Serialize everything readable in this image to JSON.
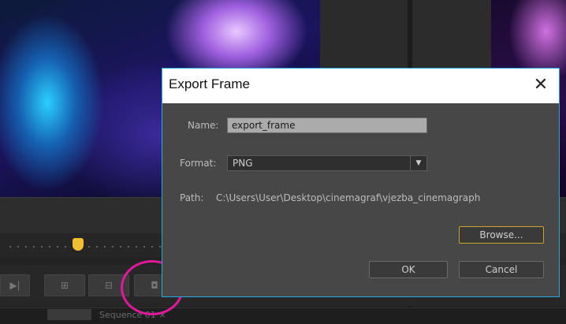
{
  "dialog": {
    "title": "Export Frame",
    "close_glyph": "✕",
    "name_label": "Name:",
    "name_value": "export_frame",
    "format_label": "Format:",
    "format_value": "PNG",
    "format_arrow": "▼",
    "path_label": "Path:",
    "path_value": "C:\\Users\\User\\Desktop\\cinemagraf\\vjezba_cinemagraph",
    "browse_label": "Browse...",
    "ok_label": "OK",
    "cancel_label": "Cancel"
  },
  "background_app": {
    "sequence_tab": "Sequence 01",
    "sequence_tab_close": "×"
  },
  "colors": {
    "dialog_border": "#28a9e0",
    "dialog_body": "#474747",
    "highlight_ring": "#e0189a",
    "playhead": "#f0c030",
    "browse_focus": "#c9a227"
  },
  "icons": [
    "close-icon",
    "dropdown-arrow-icon",
    "export-frame-camera-icon",
    "playhead-icon"
  ]
}
